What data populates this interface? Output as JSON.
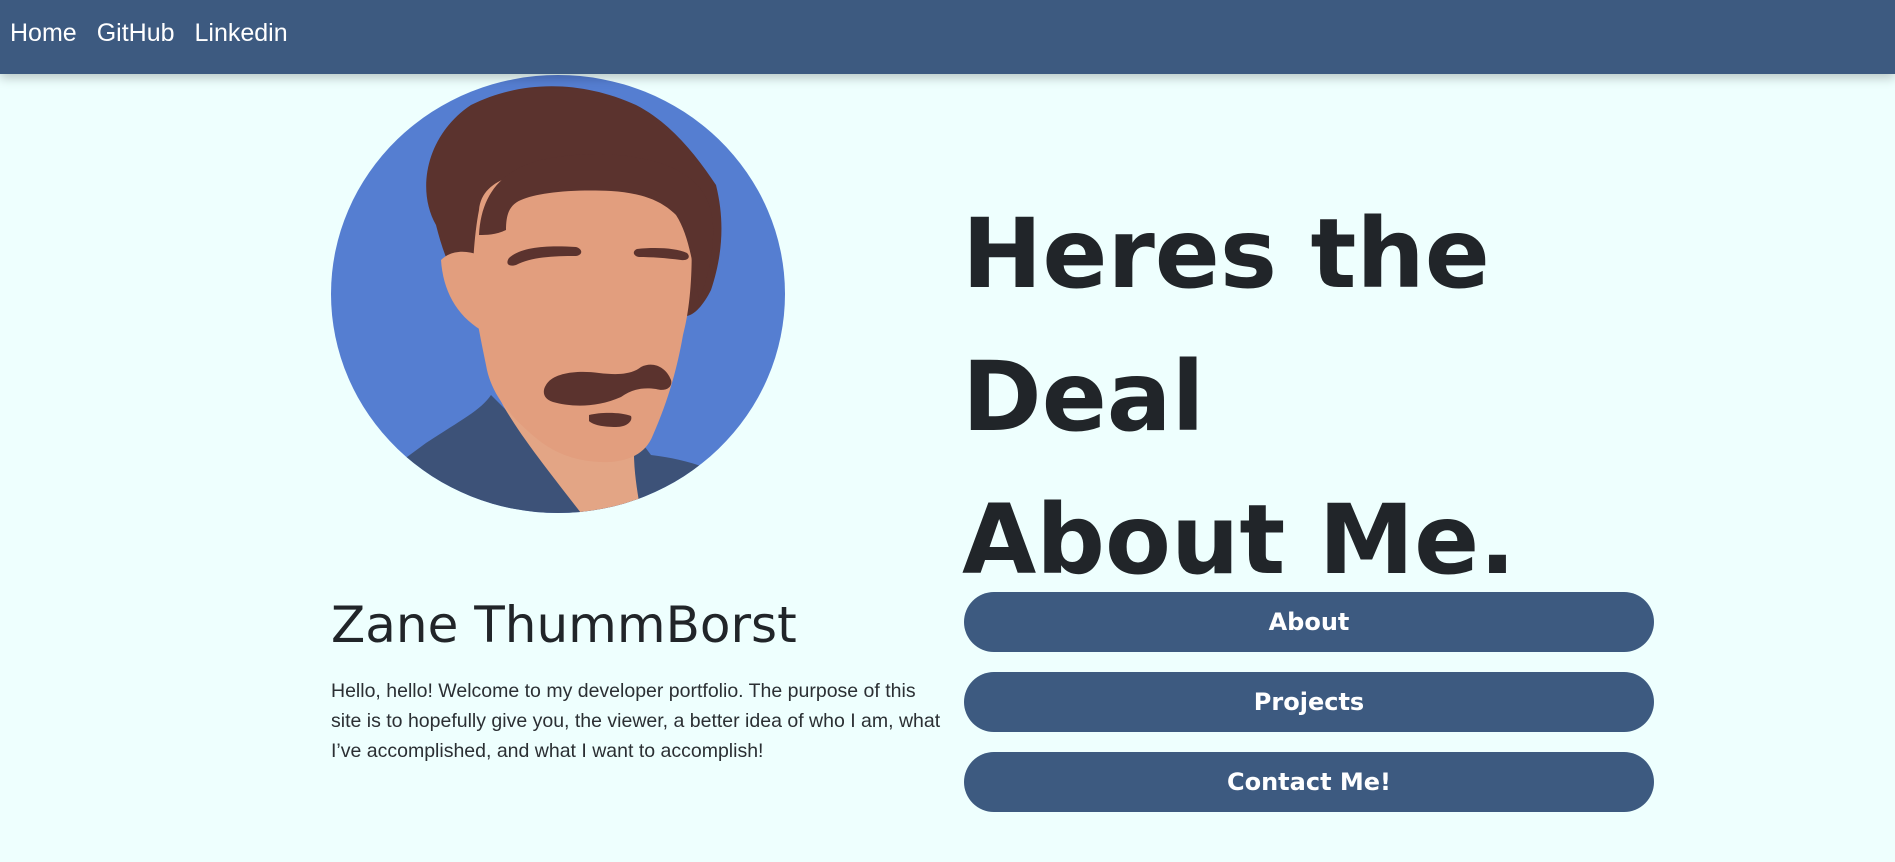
{
  "nav": {
    "items": [
      {
        "label": "Home"
      },
      {
        "label": "GitHub"
      },
      {
        "label": "Linkedin"
      }
    ]
  },
  "hero": {
    "headline_line1": "Heres the Deal",
    "headline_line2": "About Me.",
    "avatar_icon": "person-illustration-icon"
  },
  "profile": {
    "name": "Zane ThummBorst",
    "intro": "Hello, hello! Welcome to my developer portfolio. The purpose of this site is to hopefully give you, the viewer, a better idea of who I am, what I’ve accomplished, and what I want to accomplish!"
  },
  "buttons": {
    "about": "About",
    "projects": "Projects",
    "contact": "Contact Me!"
  },
  "colors": {
    "page_background": "#eefffe",
    "navbar": "#3d5a80",
    "button": "#3d5a80",
    "avatar_background": "#557ed1",
    "hair": "#5b332e",
    "skin": "#e29e7e",
    "shirt": "#3d5278",
    "text": "#212529"
  }
}
